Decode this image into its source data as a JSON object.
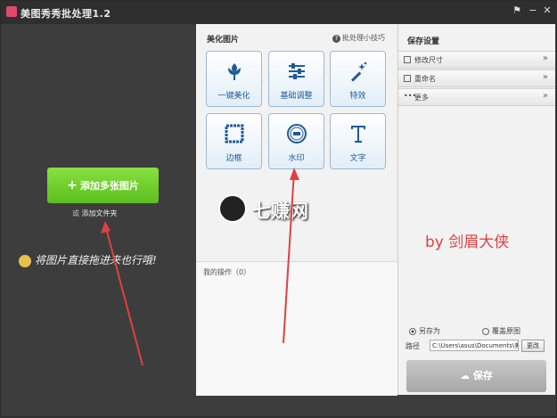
{
  "window": {
    "title": "美图秀秀批处理1.2"
  },
  "left": {
    "add_button": "添加多张图片",
    "add_prefix": "或",
    "add_folder": "添加文件夹",
    "drag_hint": "将图片直接拖进来也行哦!"
  },
  "middle": {
    "title": "美化图片",
    "tips": "批处理小技巧",
    "tiles": [
      {
        "label": "一键美化",
        "icon": "flower-icon"
      },
      {
        "label": "基础调整",
        "icon": "sliders-icon"
      },
      {
        "label": "特效",
        "icon": "magic-wand-icon"
      },
      {
        "label": "边框",
        "icon": "frame-icon"
      },
      {
        "label": "水印",
        "icon": "stamp-icon"
      },
      {
        "label": "文字",
        "icon": "text-icon"
      }
    ],
    "operations": "我的操作（0）"
  },
  "right": {
    "title": "保存设置",
    "rows": [
      "修改尺寸",
      "重命名",
      "更多"
    ],
    "watermark": "by 剑眉大侠",
    "radio_save_as": "另存为",
    "radio_overwrite": "覆盖原图",
    "path_label": "路径",
    "path_value": "C:\\Users\\asus\\Documents\\美",
    "change_button": "更改",
    "save_button": "保存"
  },
  "overlay": {
    "logo_text": "七赚网"
  },
  "colors": {
    "accent_green": "#5cbf1e",
    "tile_text": "#1d5b9a",
    "watermark": "#e04141"
  }
}
